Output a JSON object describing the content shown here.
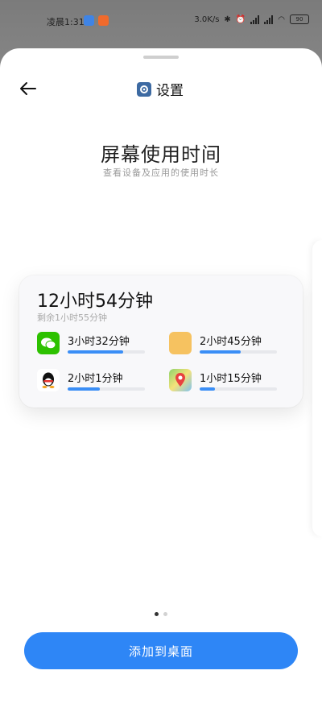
{
  "status_bar": {
    "time": "凌晨1:31",
    "network_speed": "3.0K/s",
    "battery": "90"
  },
  "header": {
    "title": "设置"
  },
  "page": {
    "title": "屏幕使用时间",
    "subtitle": "查看设备及应用的使用时长"
  },
  "widget": {
    "total_time": "12小时54分钟",
    "remaining": "剩余1小时55分钟",
    "apps": [
      {
        "icon": "wechat-icon",
        "time": "3小时32分钟",
        "progress": 0.72,
        "color": "#2dc100"
      },
      {
        "icon": "orange-app-icon",
        "time": "2小时45分钟",
        "progress": 0.53,
        "color": "#f6c260"
      },
      {
        "icon": "qq-icon",
        "time": "2小时1分钟",
        "progress": 0.42,
        "color": "#111111"
      },
      {
        "icon": "maps-icon",
        "time": "1小时15分钟",
        "progress": 0.2,
        "color": "#4caf50"
      }
    ]
  },
  "pager": {
    "count": 2,
    "active": 0
  },
  "add_button": {
    "label": "添加到桌面",
    "color": "#2e86f6"
  }
}
